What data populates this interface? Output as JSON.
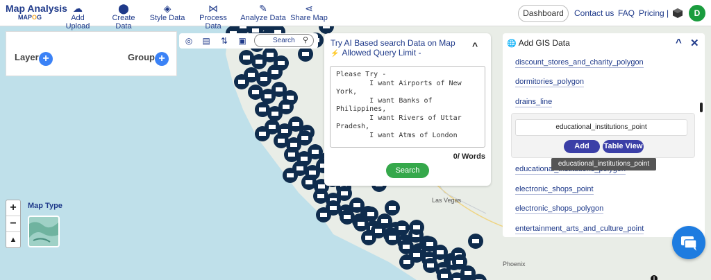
{
  "app": {
    "title": "Map Analysis",
    "logo_text": "MAP",
    "logo_accent": "O",
    "logo_suffix": "G"
  },
  "nav": [
    {
      "label": "Add Upload",
      "icon": "cloud-upload-icon"
    },
    {
      "label": "Create Data",
      "icon": "location-pin-icon"
    },
    {
      "label": "Style Data",
      "icon": "paint-bucket-icon"
    },
    {
      "label": "Process Data",
      "icon": "process-nodes-icon"
    },
    {
      "label": "Analyze Data",
      "icon": "analyze-icon"
    },
    {
      "label": "Share Map",
      "icon": "share-icon"
    }
  ],
  "header": {
    "dashboard_label": "Dashboard",
    "contact_label": "Contact us",
    "faq_label": "FAQ",
    "pricing_label": "Pricing |",
    "avatar_initial": "D"
  },
  "layer_panel": {
    "layer_label": "Layer",
    "group_label": "Group"
  },
  "map_tools": {
    "search_placeholder": "Search"
  },
  "ai_search": {
    "title_line1": "Try AI Based search Data on Map",
    "title_line2": "Allowed Query Limit -",
    "prompt_text": "Please Try -\n        I want Airports of New York,\n        I want Banks of Philippines,\n        I want Rivers of Uttar Pradesh,\n        I want Atms of London",
    "word_count": "0/ Words",
    "search_label": "Search"
  },
  "gis_panel": {
    "title": "Add GIS Data",
    "items_before": [
      "discount_stores_and_charity_polygon",
      "dormitories_polygon",
      "drains_line"
    ],
    "selected_item": "educational_institutions_point",
    "add_label": "Add",
    "table_view_label": "Table View",
    "items_after": [
      "educational_institutions_polygon",
      "electronic_shops_point",
      "electronic_shops_polygon",
      "entertainment_arts_and_culture_point"
    ],
    "tooltip": "educational_institutions_point"
  },
  "map": {
    "map_type_label": "Map Type",
    "cities": [
      "Las Vegas",
      "Phoenix"
    ],
    "colors": {
      "marker": "#0f2c4d",
      "land": "#e8ece6",
      "water": "#bfe0ea"
    }
  },
  "zoom": {
    "in": "+",
    "out": "−",
    "reset": "▲"
  }
}
